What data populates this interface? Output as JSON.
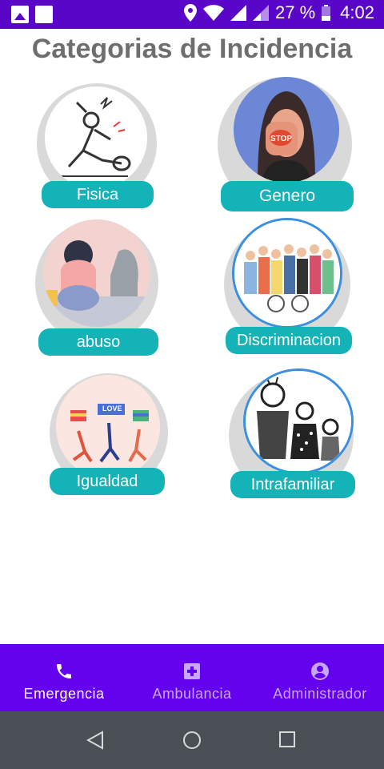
{
  "status_bar": {
    "battery": "27 %",
    "time": "4:02"
  },
  "page": {
    "title": "Categorias de Incidencia"
  },
  "categories": [
    {
      "label": "Fisica",
      "icon": "physical-violence-illustration"
    },
    {
      "label": "Genero",
      "icon": "gender-violence-illustration"
    },
    {
      "label": "abuso",
      "icon": "abuse-illustration"
    },
    {
      "label": "Discriminacion",
      "icon": "discrimination-illustration"
    },
    {
      "label": "Igualdad",
      "icon": "equality-illustration"
    },
    {
      "label": "Intrafamiliar",
      "icon": "domestic-violence-illustration"
    }
  ],
  "equality_banner": "LOVE",
  "gender_sign": "STOP",
  "bottom_nav": {
    "items": [
      {
        "label": "Emergencia",
        "icon": "phone-icon",
        "active": true
      },
      {
        "label": "Ambulancia",
        "icon": "medical-cross-icon",
        "active": false
      },
      {
        "label": "Administrador",
        "icon": "account-icon",
        "active": false
      }
    ]
  },
  "colors": {
    "status_bar": "#5a06c9",
    "bottom_nav": "#6402ee",
    "label_pill": "#14b3b8",
    "title": "#6e6e6e",
    "system_nav": "#4a4f55"
  }
}
